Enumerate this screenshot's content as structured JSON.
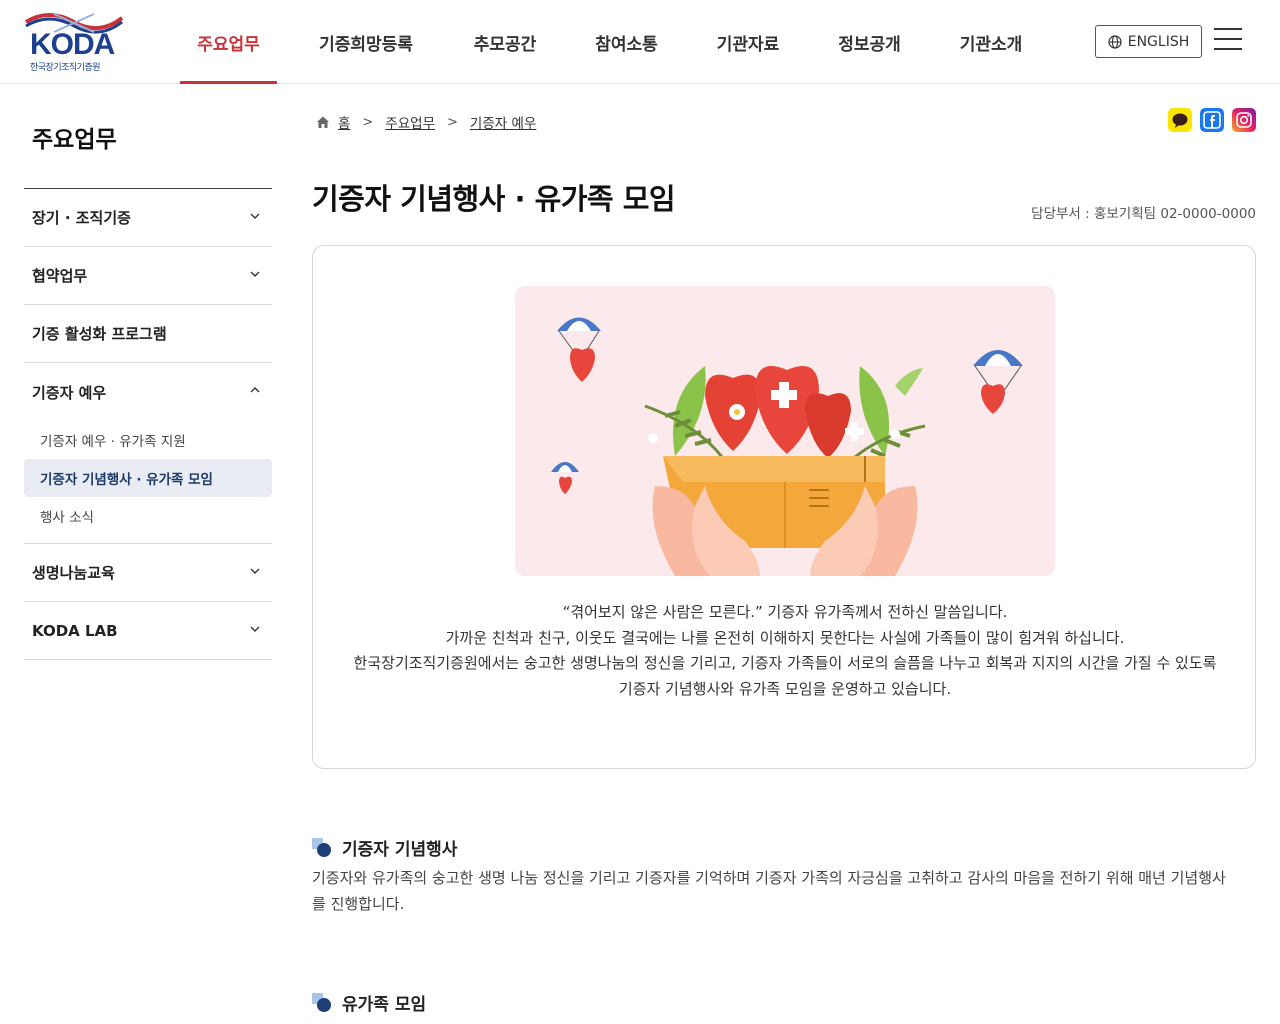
{
  "header": {
    "logo_text": "KODA",
    "logo_sub": "한국장기조직기증원",
    "nav": [
      "주요업무",
      "기증희망등록",
      "추모공간",
      "참여소통",
      "기관자료",
      "정보공개",
      "기관소개"
    ],
    "english_label": "ENGLISH"
  },
  "sidebar": {
    "title": "주요업무",
    "items": [
      {
        "label": "장기 · 조직기증"
      },
      {
        "label": "협약업무"
      },
      {
        "label": "기증 활성화 프로그램"
      },
      {
        "label": "기증자 예우"
      },
      {
        "label": "생명나눔교육"
      },
      {
        "label": "KODA LAB"
      }
    ],
    "subitems": [
      "기증자 예우 · 유가족 지원",
      "기증자 기념행사 · 유가족 모임",
      "행사 소식"
    ]
  },
  "breadcrumb": [
    "홈",
    "주요업무",
    "기증자 예우"
  ],
  "page": {
    "title": "기증자 기념행사 · 유가족 모임",
    "dept": "담당부서 : 홍보기획팀 02-0000-0000"
  },
  "intro": {
    "lines": [
      "“겪어보지 않은 사람은 모른다.” 기증자 유가족께서 전하신 말씀입니다.",
      "가까운 친척과 친구, 이웃도 결국에는 나를 온전히 이해하지 못한다는 사실에 가족들이 많이 힘겨워 하십니다.",
      "한국장기조직기증원에서는 숭고한 생명나눔의 정신을 기리고, 기증자 가족들이 서로의 슬픔을 나누고 회복과 지지의 시간을 가질 수 있도록",
      "기증자 기념행사와 유가족 모임을 운영하고 있습니다."
    ]
  },
  "sections": [
    {
      "title": "기증자 기념행사",
      "desc": "기증자와 유가족의 숭고한 생명 나눔 정신을 기리고 기증자를 기억하며 기증자 가족의 자긍심을 고취하고 감사의 마음을 전하기 위해 매년 기념행사를 진행합니다."
    },
    {
      "title": "유가족 모임"
    }
  ],
  "colors": {
    "accent": "#c8323a",
    "brand": "#1d3f8f",
    "active_bg": "#e9edf3"
  }
}
